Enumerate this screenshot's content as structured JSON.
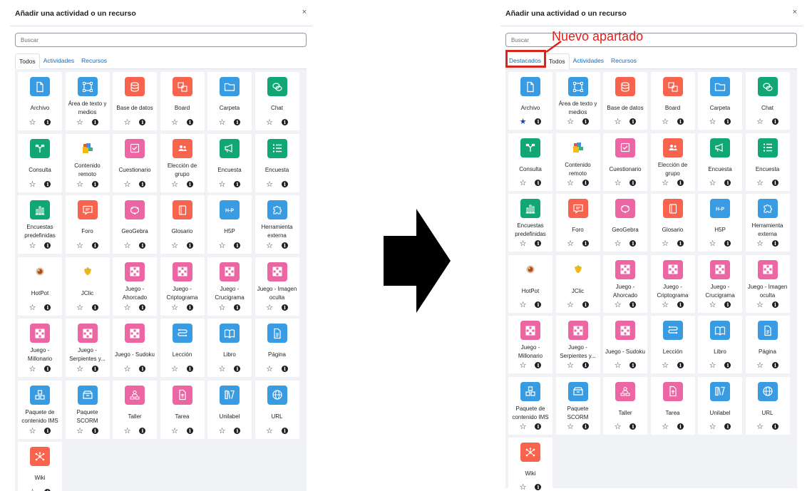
{
  "left": {
    "title": "Añadir una actividad o un recurso",
    "close": "×",
    "search_placeholder": "Buscar",
    "tabs": [
      "Todos",
      "Actividades",
      "Recursos"
    ],
    "items": [
      {
        "label": "Archivo",
        "icon": "file-icon",
        "color": "blue",
        "starred": false
      },
      {
        "label": "Área de texto y medios",
        "icon": "text-media-icon",
        "color": "blue",
        "starred": false
      },
      {
        "label": "Base de datos",
        "icon": "database-icon",
        "color": "red",
        "starred": false
      },
      {
        "label": "Board",
        "icon": "board-icon",
        "color": "red",
        "starred": false
      },
      {
        "label": "Carpeta",
        "icon": "folder-icon",
        "color": "blue",
        "starred": false
      },
      {
        "label": "Chat",
        "icon": "chat-icon",
        "color": "green",
        "starred": false
      },
      {
        "label": "Consulta",
        "icon": "choice-icon",
        "color": "green",
        "starred": false
      },
      {
        "label": "Contenido remoto",
        "icon": "remote-content-icon",
        "color": "plain",
        "starred": false
      },
      {
        "label": "Cuestionario",
        "icon": "quiz-icon",
        "color": "pink",
        "starred": false
      },
      {
        "label": "Elección de grupo",
        "icon": "group-choice-icon",
        "color": "red",
        "starred": false
      },
      {
        "label": "Encuesta",
        "icon": "feedback-icon",
        "color": "green",
        "starred": false
      },
      {
        "label": "Encuesta",
        "icon": "survey-list-icon",
        "color": "green",
        "starred": false
      },
      {
        "label": "Encuestas predefinidas",
        "icon": "bar-chart-icon",
        "color": "green",
        "starred": false
      },
      {
        "label": "Foro",
        "icon": "forum-icon",
        "color": "red",
        "starred": false
      },
      {
        "label": "GeoGebra",
        "icon": "geogebra-icon",
        "color": "pink",
        "starred": false
      },
      {
        "label": "Glosario",
        "icon": "glossary-icon",
        "color": "red",
        "starred": false
      },
      {
        "label": "H5P",
        "icon": "h5p-icon",
        "color": "blue",
        "starred": false
      },
      {
        "label": "Herramienta externa",
        "icon": "puzzle-icon",
        "color": "blue",
        "starred": false
      },
      {
        "label": "HotPot",
        "icon": "hotpot-icon",
        "color": "plain",
        "starred": false
      },
      {
        "label": "JClic",
        "icon": "jclic-icon",
        "color": "plain",
        "starred": false
      },
      {
        "label": "Juego - Ahorcado",
        "icon": "game-icon",
        "color": "pink",
        "starred": false
      },
      {
        "label": "Juego - Criptograma",
        "icon": "game-icon",
        "color": "pink",
        "starred": false
      },
      {
        "label": "Juego - Crucigrama",
        "icon": "game-icon",
        "color": "pink",
        "starred": false
      },
      {
        "label": "Juego - Imagen oculta",
        "icon": "game-icon",
        "color": "pink",
        "starred": false
      },
      {
        "label": "Juego - Millonario",
        "icon": "game-icon",
        "color": "pink",
        "starred": false
      },
      {
        "label": "Juego - Serpientes y...",
        "icon": "game-icon",
        "color": "pink",
        "starred": false
      },
      {
        "label": "Juego - Sudoku",
        "icon": "game-icon",
        "color": "pink",
        "starred": false
      },
      {
        "label": "Lección",
        "icon": "lesson-icon",
        "color": "blue",
        "starred": false
      },
      {
        "label": "Libro",
        "icon": "book-icon",
        "color": "blue",
        "starred": false
      },
      {
        "label": "Página",
        "icon": "page-icon",
        "color": "blue",
        "starred": false
      },
      {
        "label": "Paquete de contenido IMS",
        "icon": "ims-package-icon",
        "color": "blue",
        "starred": false
      },
      {
        "label": "Paquete SCORM",
        "icon": "scorm-package-icon",
        "color": "blue",
        "starred": false
      },
      {
        "label": "Taller",
        "icon": "workshop-icon",
        "color": "pink",
        "starred": false
      },
      {
        "label": "Tarea",
        "icon": "assignment-icon",
        "color": "pink",
        "starred": false
      },
      {
        "label": "Unilabel",
        "icon": "unilabel-icon",
        "color": "blue",
        "starred": false
      },
      {
        "label": "URL",
        "icon": "globe-icon",
        "color": "blue",
        "starred": false
      },
      {
        "label": "Wiki",
        "icon": "wiki-icon",
        "color": "red",
        "starred": false
      }
    ]
  },
  "right": {
    "title": "Añadir una actividad o un recurso",
    "close": "×",
    "search_placeholder": "Buscar",
    "tabs": [
      "Destacados",
      "Todos",
      "Actividades",
      "Recursos"
    ],
    "starred_item": "Archivo"
  },
  "annotation": {
    "text": "Nuevo apartado",
    "color": "#e0201b"
  },
  "colors": {
    "blue": "#399be2",
    "red": "#f7634d",
    "green": "#11a676",
    "pink": "#eb66a2",
    "link": "#0f6cbf",
    "starred": "#0f47ad"
  },
  "glyphs": {
    "star_empty": "☆",
    "star_filled": "★",
    "info": "i"
  }
}
